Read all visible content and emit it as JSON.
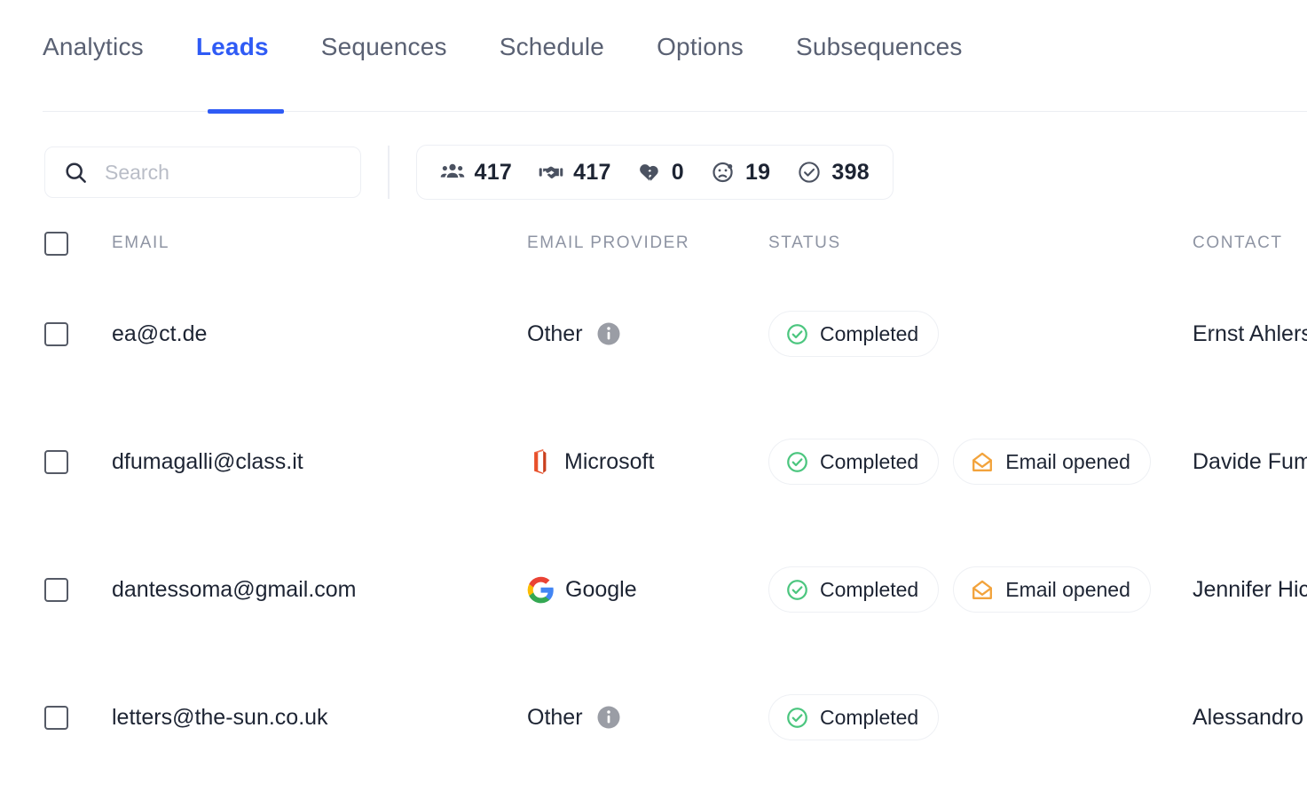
{
  "tabs": [
    {
      "label": "Analytics",
      "active": false
    },
    {
      "label": "Leads",
      "active": true
    },
    {
      "label": "Sequences",
      "active": false
    },
    {
      "label": "Schedule",
      "active": false
    },
    {
      "label": "Options",
      "active": false
    },
    {
      "label": "Subsequences",
      "active": false
    }
  ],
  "search": {
    "placeholder": "Search",
    "value": "",
    "icon": "search-icon"
  },
  "stats": [
    {
      "icon": "people-group-icon",
      "name": "total-leads",
      "value": "417"
    },
    {
      "icon": "handshake-icon",
      "name": "contacted",
      "value": "417"
    },
    {
      "icon": "broken-heart-icon",
      "name": "unsubscribed",
      "value": "0"
    },
    {
      "icon": "sad-face-icon",
      "name": "bounced",
      "value": "19"
    },
    {
      "icon": "check-circle-icon",
      "name": "completed",
      "value": "398"
    }
  ],
  "table": {
    "columns": [
      {
        "key": "email",
        "label": "EMAIL"
      },
      {
        "key": "provider",
        "label": "EMAIL PROVIDER"
      },
      {
        "key": "status",
        "label": "STATUS"
      },
      {
        "key": "contact",
        "label": "CONTACT"
      }
    ],
    "rows": [
      {
        "checked": false,
        "email": "ea@ct.de",
        "provider": "Other",
        "provider_logo": "info-icon",
        "statuses": [
          {
            "label": "Completed",
            "icon": "check-circle-icon"
          }
        ],
        "contact": "Ernst Ahlers"
      },
      {
        "checked": false,
        "email": "dfumagalli@class.it",
        "provider": "Microsoft",
        "provider_logo": "microsoft-logo-icon",
        "statuses": [
          {
            "label": "Completed",
            "icon": "check-circle-icon"
          },
          {
            "label": "Email opened",
            "icon": "open-envelope-icon"
          }
        ],
        "contact": "Davide Fumagalli"
      },
      {
        "checked": false,
        "email": "dantessoma@gmail.com",
        "provider": "Google",
        "provider_logo": "google-logo-icon",
        "statuses": [
          {
            "label": "Completed",
            "icon": "check-circle-icon"
          },
          {
            "label": "Email opened",
            "icon": "open-envelope-icon"
          }
        ],
        "contact": "Jennifer Hicks"
      },
      {
        "checked": false,
        "email": "letters@the-sun.co.uk",
        "provider": "Other",
        "provider_logo": "info-icon",
        "statuses": [
          {
            "label": "Completed",
            "icon": "check-circle-icon"
          }
        ],
        "contact": "Alessandro"
      }
    ]
  },
  "colors": {
    "accent": "#2f5bf5",
    "text": "#1d2433",
    "muted": "#8e94a3",
    "border": "#edeff4",
    "success": "#4cc67f",
    "warning": "#f2a33c",
    "microsoft": "#e8502a",
    "info": "#9a9da5"
  }
}
